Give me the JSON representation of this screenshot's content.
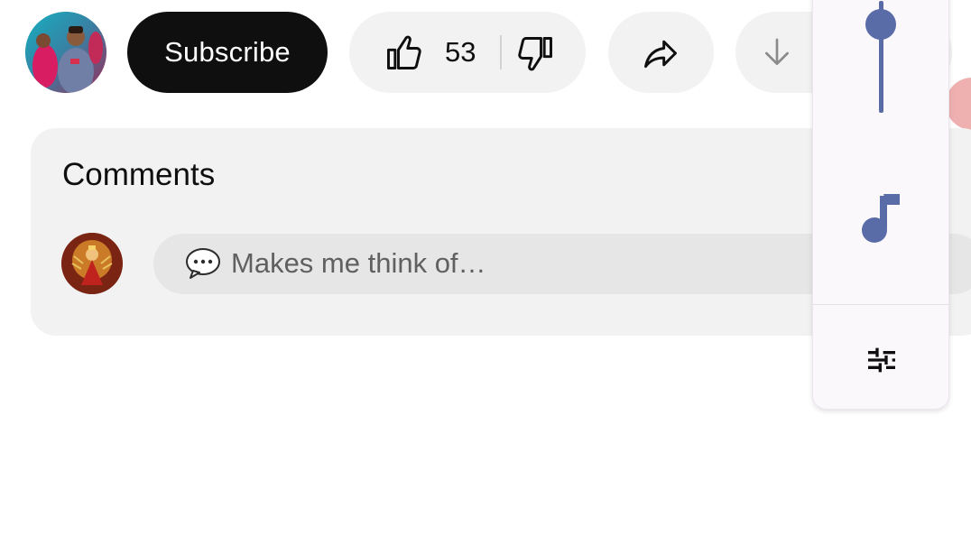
{
  "channel": {
    "avatar_icon": "channel-avatar-photo"
  },
  "actions": {
    "subscribe_label": "Subscribe",
    "like_count": "53",
    "like_icon": "thumbs-up-icon",
    "dislike_icon": "thumbs-down-icon",
    "share_icon": "share-arrow-icon",
    "download_icon": "download-arrow-icon"
  },
  "comments": {
    "title": "Comments",
    "input_emoji": "💬",
    "input_placeholder": "Makes me think of…",
    "user_avatar_icon": "user-avatar-photo"
  },
  "side_panel": {
    "slider_icon": "volume-slider",
    "slider_level": 0.85,
    "music_icon": "music-note-icon",
    "settings_icon": "tune-icon",
    "accent_color": "#5a6ca8"
  },
  "colors": {
    "subscribe_bg": "#0f0f0f",
    "pill_bg": "#f2f2f2",
    "card_bg": "#f2f2f2",
    "input_bg": "#e6e6e6"
  }
}
